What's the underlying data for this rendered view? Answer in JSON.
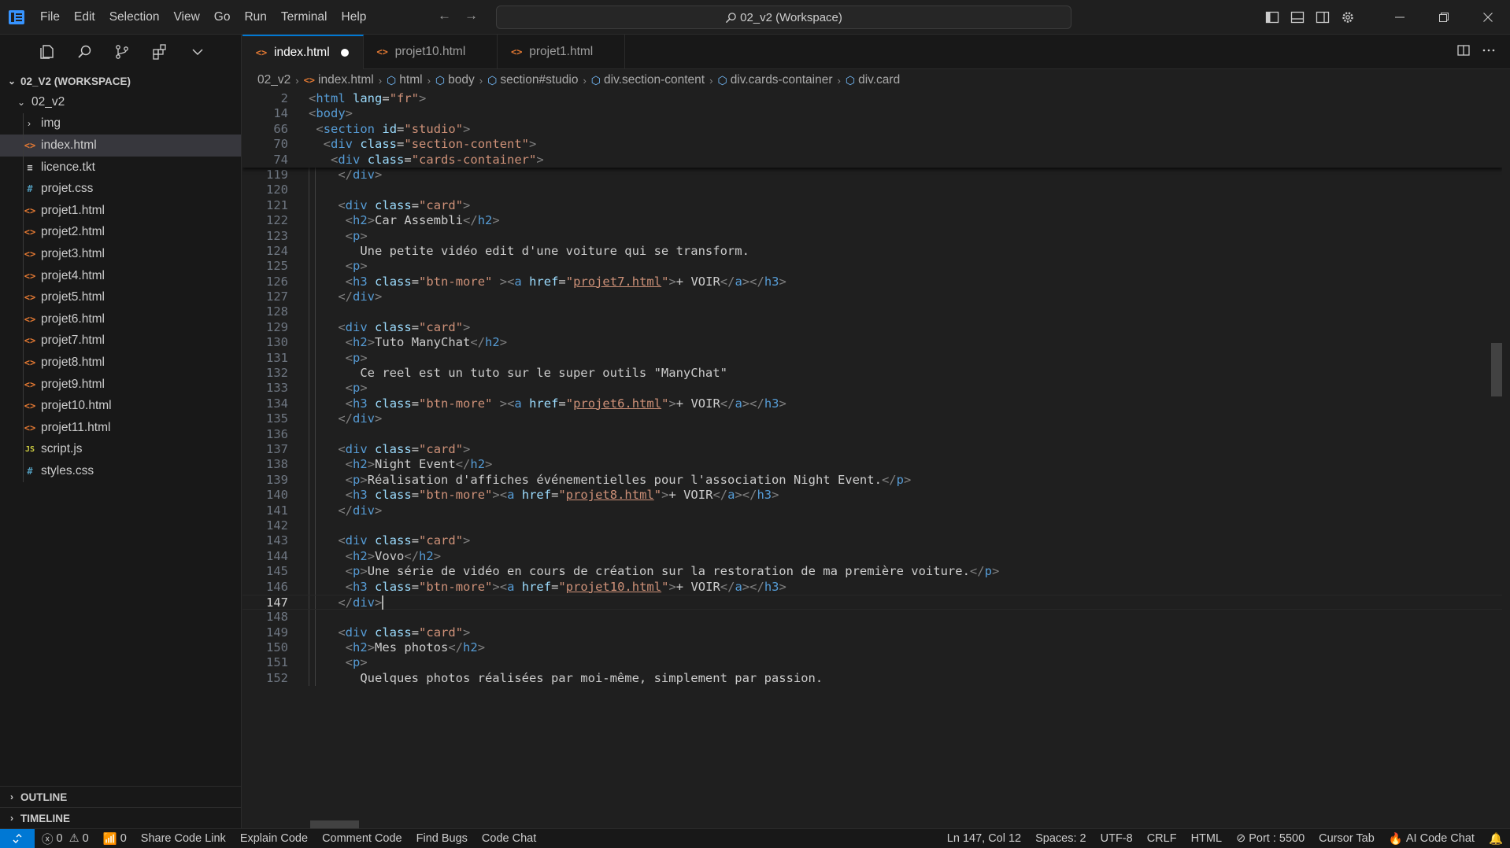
{
  "menu": [
    "File",
    "Edit",
    "Selection",
    "View",
    "Go",
    "Run",
    "Terminal",
    "Help"
  ],
  "search": {
    "text": "02_v2 (Workspace)"
  },
  "sidebar": {
    "workspace_label": "02_V2 (WORKSPACE)",
    "folder": "02_v2",
    "items": [
      {
        "label": "img",
        "type": "folder"
      },
      {
        "label": "index.html",
        "type": "html"
      },
      {
        "label": "licence.tkt",
        "type": "txt"
      },
      {
        "label": "projet.css",
        "type": "css"
      },
      {
        "label": "projet1.html",
        "type": "html"
      },
      {
        "label": "projet2.html",
        "type": "html"
      },
      {
        "label": "projet3.html",
        "type": "html"
      },
      {
        "label": "projet4.html",
        "type": "html"
      },
      {
        "label": "projet5.html",
        "type": "html"
      },
      {
        "label": "projet6.html",
        "type": "html"
      },
      {
        "label": "projet7.html",
        "type": "html"
      },
      {
        "label": "projet8.html",
        "type": "html"
      },
      {
        "label": "projet9.html",
        "type": "html"
      },
      {
        "label": "projet10.html",
        "type": "html"
      },
      {
        "label": "projet11.html",
        "type": "html"
      },
      {
        "label": "script.js",
        "type": "js"
      },
      {
        "label": "styles.css",
        "type": "css"
      }
    ],
    "outline": "OUTLINE",
    "timeline": "TIMELINE"
  },
  "tabs": [
    {
      "label": "index.html",
      "active": true,
      "dirty": true
    },
    {
      "label": "projet10.html",
      "active": false
    },
    {
      "label": "projet1.html",
      "active": false
    }
  ],
  "breadcrumb": [
    "02_v2",
    "index.html",
    "html",
    "body",
    "section#studio",
    "div.section-content",
    "div.cards-container",
    "div.card"
  ],
  "sticky_lines": [
    {
      "n": "2",
      "code": "<html lang=\"fr\">"
    },
    {
      "n": "14",
      "code": "<body>"
    },
    {
      "n": "66",
      "code": " <section id=\"studio\">"
    },
    {
      "n": "70",
      "code": "  <div class=\"section-content\">"
    },
    {
      "n": "74",
      "code": "   <div class=\"cards-container\">"
    }
  ],
  "code_lines": [
    {
      "n": "119",
      "code": "    </div>"
    },
    {
      "n": "120",
      "code": ""
    },
    {
      "n": "121",
      "code": "    <div class=\"card\">"
    },
    {
      "n": "122",
      "code": "     <h2>Car Assembli</h2>"
    },
    {
      "n": "123",
      "code": "     <p>"
    },
    {
      "n": "124",
      "code": "       Une petite vidéo edit d'une voiture qui se transform."
    },
    {
      "n": "125",
      "code": "     <p>"
    },
    {
      "n": "126",
      "code": "     <h3 class=\"btn-more\" ><a href=\"projet7.html\">+ VOIR</a></h3>"
    },
    {
      "n": "127",
      "code": "    </div>"
    },
    {
      "n": "128",
      "code": ""
    },
    {
      "n": "129",
      "code": "    <div class=\"card\">"
    },
    {
      "n": "130",
      "code": "     <h2>Tuto ManyChat</h2>"
    },
    {
      "n": "131",
      "code": "     <p>"
    },
    {
      "n": "132",
      "code": "       Ce reel est un tuto sur le super outils \"ManyChat\""
    },
    {
      "n": "133",
      "code": "     <p>"
    },
    {
      "n": "134",
      "code": "     <h3 class=\"btn-more\" ><a href=\"projet6.html\">+ VOIR</a></h3>"
    },
    {
      "n": "135",
      "code": "    </div>"
    },
    {
      "n": "136",
      "code": ""
    },
    {
      "n": "137",
      "code": "    <div class=\"card\">"
    },
    {
      "n": "138",
      "code": "     <h2>Night Event</h2>"
    },
    {
      "n": "139",
      "code": "     <p>Réalisation d'affiches événementielles pour l'association Night Event.</p>"
    },
    {
      "n": "140",
      "code": "     <h3 class=\"btn-more\"><a href=\"projet8.html\">+ VOIR</a></h3>"
    },
    {
      "n": "141",
      "code": "    </div>"
    },
    {
      "n": "142",
      "code": ""
    },
    {
      "n": "143",
      "code": "    <div class=\"card\">"
    },
    {
      "n": "144",
      "code": "     <h2>Vovo</h2>"
    },
    {
      "n": "145",
      "code": "     <p>Une série de vidéo en cours de création sur la restoration de ma première voiture.</p>"
    },
    {
      "n": "146",
      "code": "     <h3 class=\"btn-more\"><a href=\"projet10.html\">+ VOIR</a></h3>"
    },
    {
      "n": "147",
      "code": "    </div>",
      "current": true
    },
    {
      "n": "148",
      "code": ""
    },
    {
      "n": "149",
      "code": "    <div class=\"card\">"
    },
    {
      "n": "150",
      "code": "     <h2>Mes photos</h2>"
    },
    {
      "n": "151",
      "code": "     <p>"
    },
    {
      "n": "152",
      "code": "       Quelques photos réalisées par moi-même, simplement par passion."
    }
  ],
  "status": {
    "errors": "0",
    "warnings": "0",
    "ports": "0",
    "left_items": [
      "Share Code Link",
      "Explain Code",
      "Comment Code",
      "Find Bugs",
      "Code Chat"
    ],
    "position": "Ln 147, Col 12",
    "spaces": "Spaces: 2",
    "encoding": "UTF-8",
    "eol": "CRLF",
    "language": "HTML",
    "port": "Port : 5500",
    "cursor_tab": "Cursor Tab",
    "ai_chat": "AI Code Chat"
  },
  "colors": {
    "accent": "#0078d4",
    "tag": "#569cd6",
    "attr": "#9cdcfe",
    "string": "#ce9178",
    "html_icon": "#e37933",
    "css_icon": "#519aba",
    "js_icon": "#cbcb41"
  }
}
